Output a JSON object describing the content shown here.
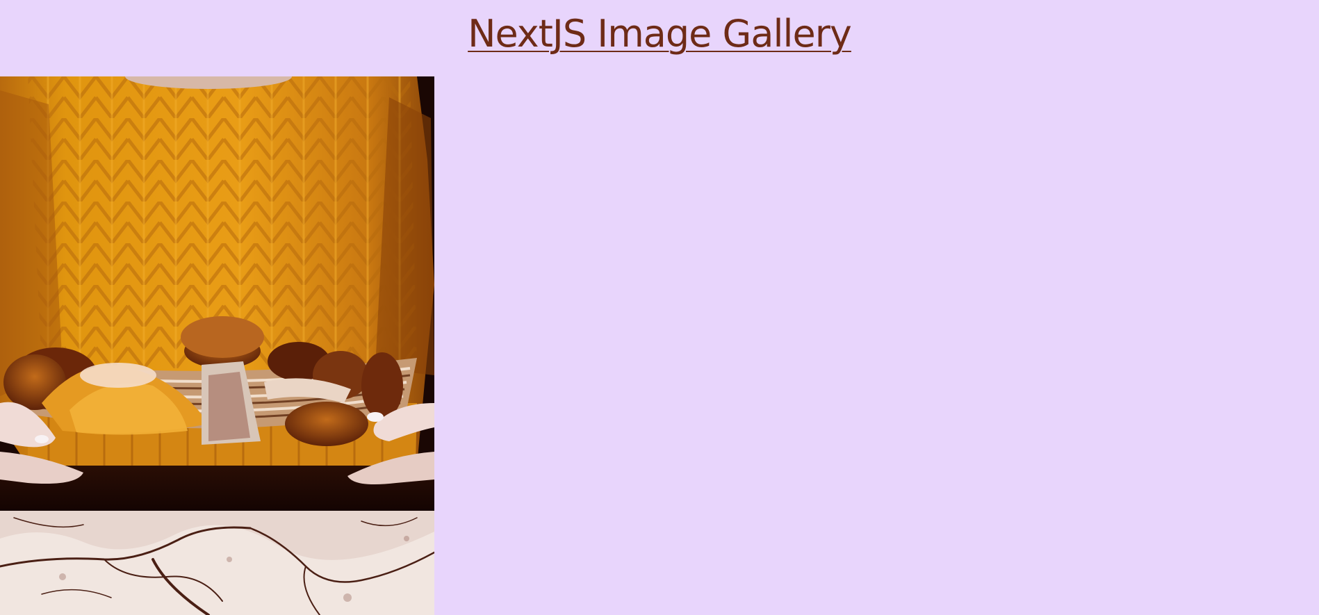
{
  "header": {
    "title": "NextJS Image Gallery"
  },
  "gallery": {
    "images": [
      {
        "subject": "hands-holding-mushroom-basket",
        "icon": "photo-icon"
      },
      {
        "subject": "marble-stone-texture",
        "icon": "photo-icon"
      }
    ]
  },
  "colors": {
    "background": "#e8d5fc",
    "title": "#6e2b17",
    "sweater": "#d98a14",
    "dark": "#1a0704",
    "marble": "#f1e6e0"
  }
}
